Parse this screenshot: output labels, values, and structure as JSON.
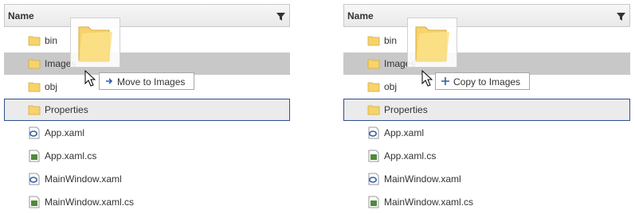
{
  "left_panel": {
    "header": {
      "title": "Name",
      "filter_icon": "filter-icon"
    },
    "rows": [
      {
        "label": "bin",
        "icon": "folder-icon"
      },
      {
        "label": "Images",
        "icon": "folder-icon"
      },
      {
        "label": "obj",
        "icon": "folder-icon"
      },
      {
        "label": "Properties",
        "icon": "folder-icon"
      },
      {
        "label": "App.xaml",
        "icon": "xaml-file-icon"
      },
      {
        "label": "App.xaml.cs",
        "icon": "cs-file-icon"
      },
      {
        "label": "MainWindow.xaml",
        "icon": "xaml-file-icon"
      },
      {
        "label": "MainWindow.xaml.cs",
        "icon": "cs-file-icon"
      }
    ],
    "drag_tooltip": {
      "icon": "arrow-right-icon",
      "label": "Move to Images"
    }
  },
  "right_panel": {
    "header": {
      "title": "Name",
      "filter_icon": "filter-icon"
    },
    "rows": [
      {
        "label": "bin",
        "icon": "folder-icon"
      },
      {
        "label": "Images",
        "icon": "folder-icon"
      },
      {
        "label": "obj",
        "icon": "folder-icon"
      },
      {
        "label": "Properties",
        "icon": "folder-icon"
      },
      {
        "label": "App.xaml",
        "icon": "xaml-file-icon"
      },
      {
        "label": "App.xaml.cs",
        "icon": "cs-file-icon"
      },
      {
        "label": "MainWindow.xaml",
        "icon": "xaml-file-icon"
      },
      {
        "label": "MainWindow.xaml.cs",
        "icon": "cs-file-icon"
      }
    ],
    "drag_tooltip": {
      "icon": "plus-icon",
      "label": "Copy to Images"
    }
  },
  "colors": {
    "selected_row": "#c8c8c8",
    "current_row_border": "#2f4f8f",
    "folder": "#f6d36b",
    "accent": "#2e5fa8"
  }
}
